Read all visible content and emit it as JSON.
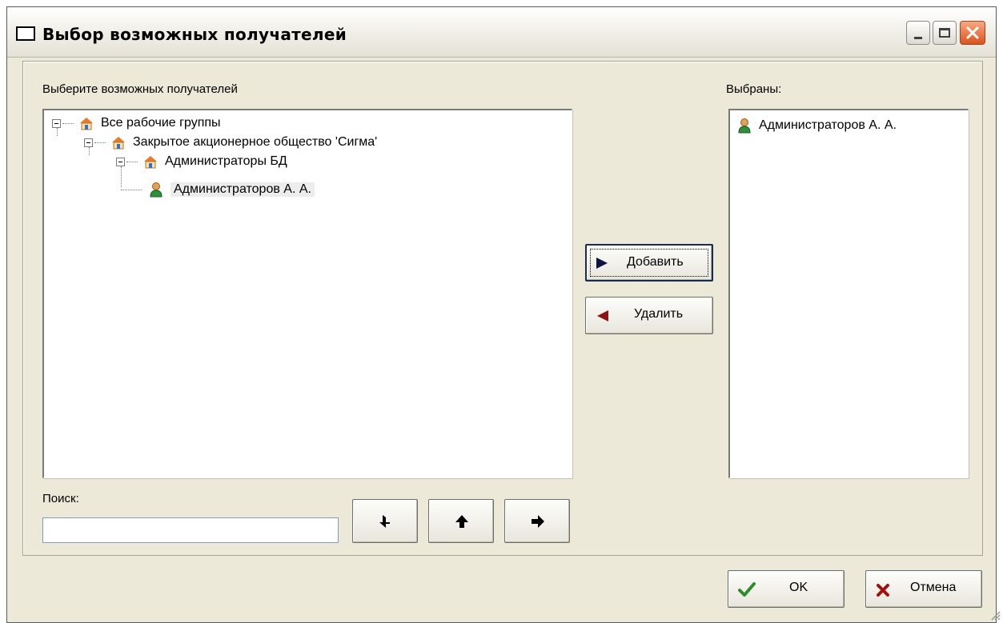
{
  "window": {
    "title": "Выбор возможных получателей"
  },
  "left_panel": {
    "label": "Выберите возможных получателей",
    "tree": [
      {
        "label": "Все рабочие группы",
        "icon": "house-icon",
        "level": 0,
        "expanded": true
      },
      {
        "label": "Закрытое акционерное общество 'Сигма'",
        "icon": "house-icon",
        "level": 1,
        "expanded": true
      },
      {
        "label": "Администраторы БД",
        "icon": "house-icon",
        "level": 2,
        "expanded": true
      },
      {
        "label": "Администраторов А. А.",
        "icon": "user-icon",
        "level": 3,
        "selected": true
      }
    ]
  },
  "right_panel": {
    "label": "Выбраны:",
    "items": [
      {
        "label": "Администраторов А. А.",
        "icon": "user-icon"
      }
    ]
  },
  "middle": {
    "add_label": "Добавить",
    "remove_label": "Удалить"
  },
  "search": {
    "label": "Поиск:",
    "value": "",
    "nav_buttons": [
      "arrow-back-icon",
      "arrow-up-icon",
      "arrow-forward-icon"
    ]
  },
  "footer": {
    "ok_label": "OK",
    "cancel_label": "Отмена"
  },
  "colors": {
    "dialog_bg": "#ece9d8",
    "add_arrow": "#0d1440",
    "remove_arrow": "#8b1414",
    "ok_check": "#2e8b2e",
    "cancel_x": "#a01010",
    "close_button": "#d9541f"
  }
}
